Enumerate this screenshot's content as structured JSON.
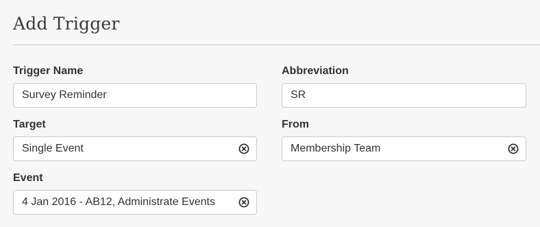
{
  "page": {
    "title": "Add Trigger"
  },
  "form": {
    "trigger_name": {
      "label": "Trigger Name",
      "value": "Survey Reminder"
    },
    "abbreviation": {
      "label": "Abbreviation",
      "value": "SR"
    },
    "target": {
      "label": "Target",
      "value": "Single Event",
      "clear_icon": "clear-circle-x-icon"
    },
    "from": {
      "label": "From",
      "value": "Membership Team",
      "clear_icon": "clear-circle-x-icon"
    },
    "event": {
      "label": "Event",
      "value": "4 Jan 2016 - AB12, Administrate Events",
      "clear_icon": "clear-circle-x-icon"
    }
  },
  "colors": {
    "background": "#f7f7f7",
    "input_background": "#ffffff",
    "input_border": "#c9c9c9",
    "text": "#333333",
    "divider": "#c8c8c8"
  }
}
